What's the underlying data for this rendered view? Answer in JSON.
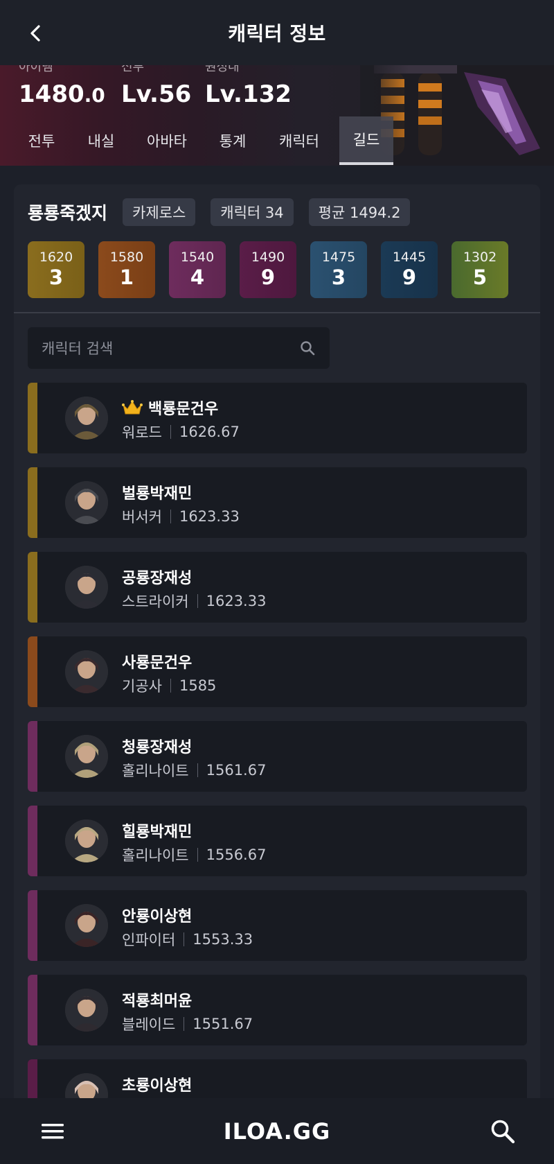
{
  "header": {
    "title": "캐릭터 정보"
  },
  "hero": {
    "stats": [
      {
        "label": "아이템",
        "value_main": "1480",
        "value_dec": ".0"
      },
      {
        "label": "전투",
        "value_main": "Lv.56",
        "value_dec": ""
      },
      {
        "label": "원정대",
        "value_main": "Lv.132",
        "value_dec": ""
      }
    ]
  },
  "tabs": [
    "전투",
    "내실",
    "아바타",
    "통계",
    "캐릭터",
    "길드"
  ],
  "active_tab": "길드",
  "guild": {
    "name": "룡룡죽겠지",
    "server": "카제로스",
    "members_label": "캐릭터 34",
    "average_label": "평균 1494.2",
    "tiers": [
      {
        "level": "1620",
        "count": "3",
        "color": "#8a6d1e",
        "color2": "#7a6018"
      },
      {
        "level": "1580",
        "count": "1",
        "color": "#8b4a1c",
        "color2": "#7a3f16"
      },
      {
        "level": "1540",
        "count": "4",
        "color": "#6e2c5d",
        "color2": "#5f2650"
      },
      {
        "level": "1490",
        "count": "9",
        "color": "#5a1d48",
        "color2": "#4e183e"
      },
      {
        "level": "1475",
        "count": "3",
        "color": "#2b5170",
        "color2": "#244662"
      },
      {
        "level": "1445",
        "count": "9",
        "color": "#1b3a55",
        "color2": "#17324a"
      },
      {
        "level": "1302",
        "count": "5",
        "color": "#4a6a2e",
        "color2": "#6a7a28"
      }
    ],
    "search_placeholder": "캐릭터 검색"
  },
  "members": [
    {
      "name": "백룡문건우",
      "class": "워로드",
      "level": "1626.67",
      "bar": "#8a6d1e",
      "crown": true
    },
    {
      "name": "벌룡박재민",
      "class": "버서커",
      "level": "1623.33",
      "bar": "#8a6d1e",
      "crown": false
    },
    {
      "name": "공룡장재성",
      "class": "스트라이커",
      "level": "1623.33",
      "bar": "#8a6d1e",
      "crown": false
    },
    {
      "name": "사룡문건우",
      "class": "기공사",
      "level": "1585",
      "bar": "#8b4a1c",
      "crown": false
    },
    {
      "name": "청룡장재성",
      "class": "홀리나이트",
      "level": "1561.67",
      "bar": "#6e2c5d",
      "crown": false
    },
    {
      "name": "힐룡박재민",
      "class": "홀리나이트",
      "level": "1556.67",
      "bar": "#6e2c5d",
      "crown": false
    },
    {
      "name": "안룡이상현",
      "class": "인파이터",
      "level": "1553.33",
      "bar": "#6e2c5d",
      "crown": false
    },
    {
      "name": "적룡최머윤",
      "class": "블레이드",
      "level": "1551.67",
      "bar": "#6e2c5d",
      "crown": false
    },
    {
      "name": "초룡이상현",
      "class": "",
      "level": "",
      "bar": "#5a1d48",
      "crown": false
    }
  ],
  "footer": {
    "logo": "ILOA.GG"
  },
  "icons": {
    "back": "chevron-left-icon",
    "search": "search-icon",
    "menu": "hamburger-menu-icon",
    "crown": "crown-icon"
  }
}
